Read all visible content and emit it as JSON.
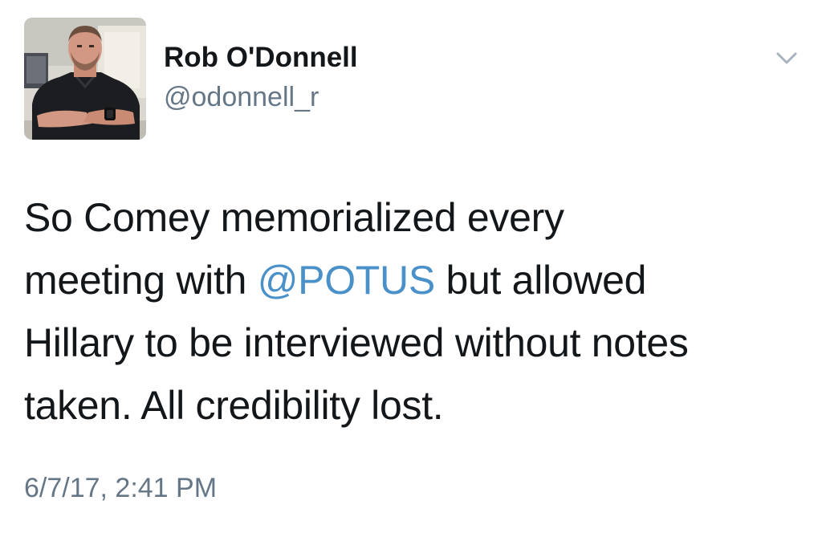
{
  "tweet": {
    "author": {
      "name": "Rob O'Donnell",
      "handle": "@odonnell_r",
      "avatar_alt": "profile photo"
    },
    "menu_icon": "chevron-down-icon",
    "text": {
      "line1": "So Comey memorialized every",
      "line2_before": "meeting with ",
      "mention": "@POTUS",
      "line2_after": " but allowed",
      "line3": "Hillary to be interviewed without notes",
      "line4": "taken. All credibility lost."
    },
    "timestamp": "6/7/17, 2:41 PM"
  },
  "colors": {
    "mention": "#4a90c9",
    "secondary_text": "#657786",
    "primary_text": "#14171a"
  }
}
